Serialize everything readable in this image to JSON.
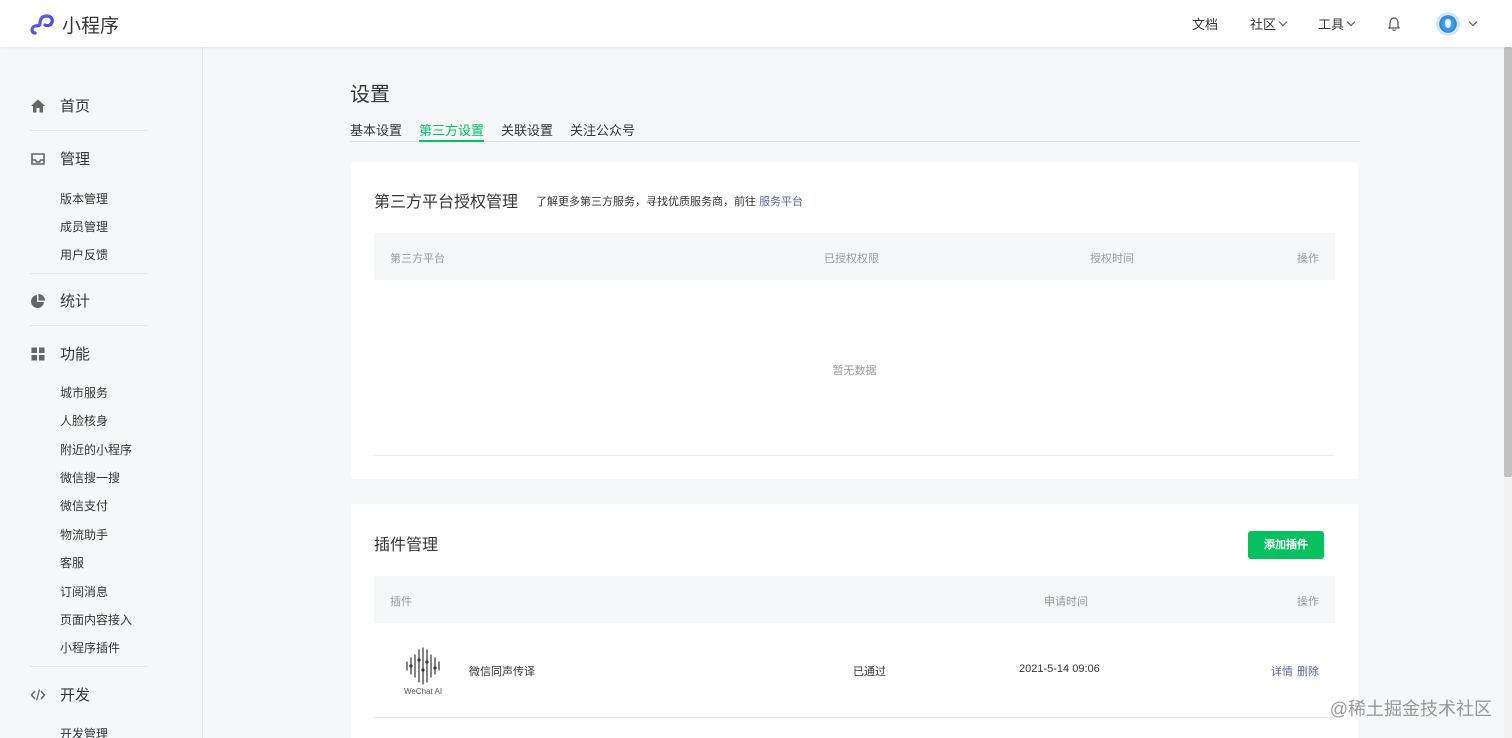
{
  "app": {
    "title": "小程序"
  },
  "topnav": {
    "docs": "文档",
    "community": "社区",
    "tools": "工具"
  },
  "sidebar": {
    "home": "首页",
    "manage": {
      "label": "管理",
      "items": [
        "版本管理",
        "成员管理",
        "用户反馈"
      ]
    },
    "stats": "统计",
    "features": {
      "label": "功能",
      "items": [
        "城市服务",
        "人脸核身",
        "附近的小程序",
        "微信搜一搜",
        "微信支付",
        "物流助手",
        "客服",
        "订阅消息",
        "页面内容接入",
        "小程序插件"
      ]
    },
    "dev": {
      "label": "开发",
      "items": [
        "开发管理"
      ]
    }
  },
  "page": {
    "title": "设置",
    "tabs": [
      "基本设置",
      "第三方设置",
      "关联设置",
      "关注公众号"
    ],
    "active_tab": 1
  },
  "third_party": {
    "title": "第三方平台授权管理",
    "subtitle": "了解更多第三方服务，寻找优质服务商，前往",
    "link": "服务平台",
    "columns": [
      "第三方平台",
      "已授权权限",
      "授权时间",
      "操作"
    ],
    "empty": "暂无数据"
  },
  "plugins": {
    "title": "插件管理",
    "add_button": "添加插件",
    "columns": [
      "插件",
      "申请时间",
      "操作"
    ],
    "rows": [
      {
        "logo_text": "WeChat AI",
        "name": "微信同声传译",
        "status": "已通过",
        "time": "2021-5-14 09:06",
        "detail": "详情",
        "delete": "删除"
      }
    ]
  },
  "watermark": "@稀土掘金技术社区",
  "colors": {
    "accent": "#07c160",
    "link": "#576b95"
  }
}
